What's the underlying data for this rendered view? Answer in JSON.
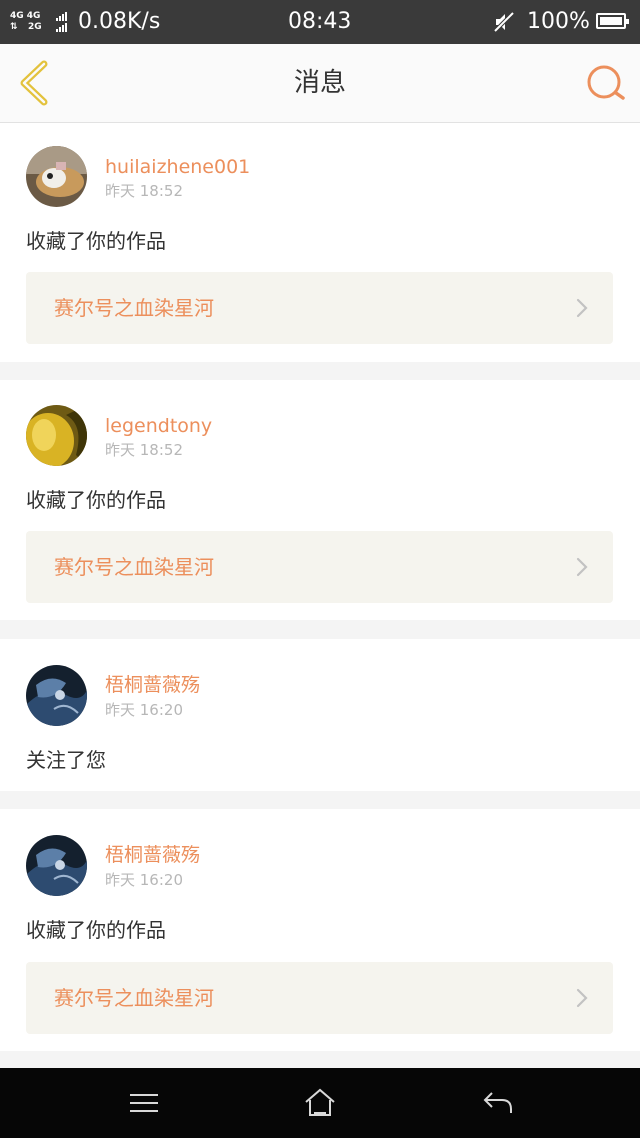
{
  "status_bar": {
    "network_top": "4G 4G",
    "network_bottom": "2G",
    "speed": "0.08K/s",
    "time": "08:43",
    "battery": "100%"
  },
  "header": {
    "title": "消息",
    "back_icon": "chevron-left-icon",
    "search_icon": "search-icon"
  },
  "colors": {
    "accent": "#ec8f5c",
    "back_icon": "#e3c23c",
    "status_bar": "#3a3a3a",
    "link_background": "#f5f4ee"
  },
  "messages": [
    {
      "username": "huilaizhene001",
      "time": "昨天 18:52",
      "action": "收藏了你的作品",
      "work_title": "赛尔号之血染星河"
    },
    {
      "username": "legendtony",
      "time": "昨天 18:52",
      "action": "收藏了你的作品",
      "work_title": "赛尔号之血染星河"
    },
    {
      "username": "梧桐蔷薇殇",
      "time": "昨天 16:20",
      "action": "关注了您"
    },
    {
      "username": "梧桐蔷薇殇",
      "time": "昨天 16:20",
      "action": "收藏了你的作品",
      "work_title": "赛尔号之血染星河"
    }
  ],
  "nav_bar": [
    "menu-icon",
    "home-icon",
    "back-arrow-icon"
  ]
}
